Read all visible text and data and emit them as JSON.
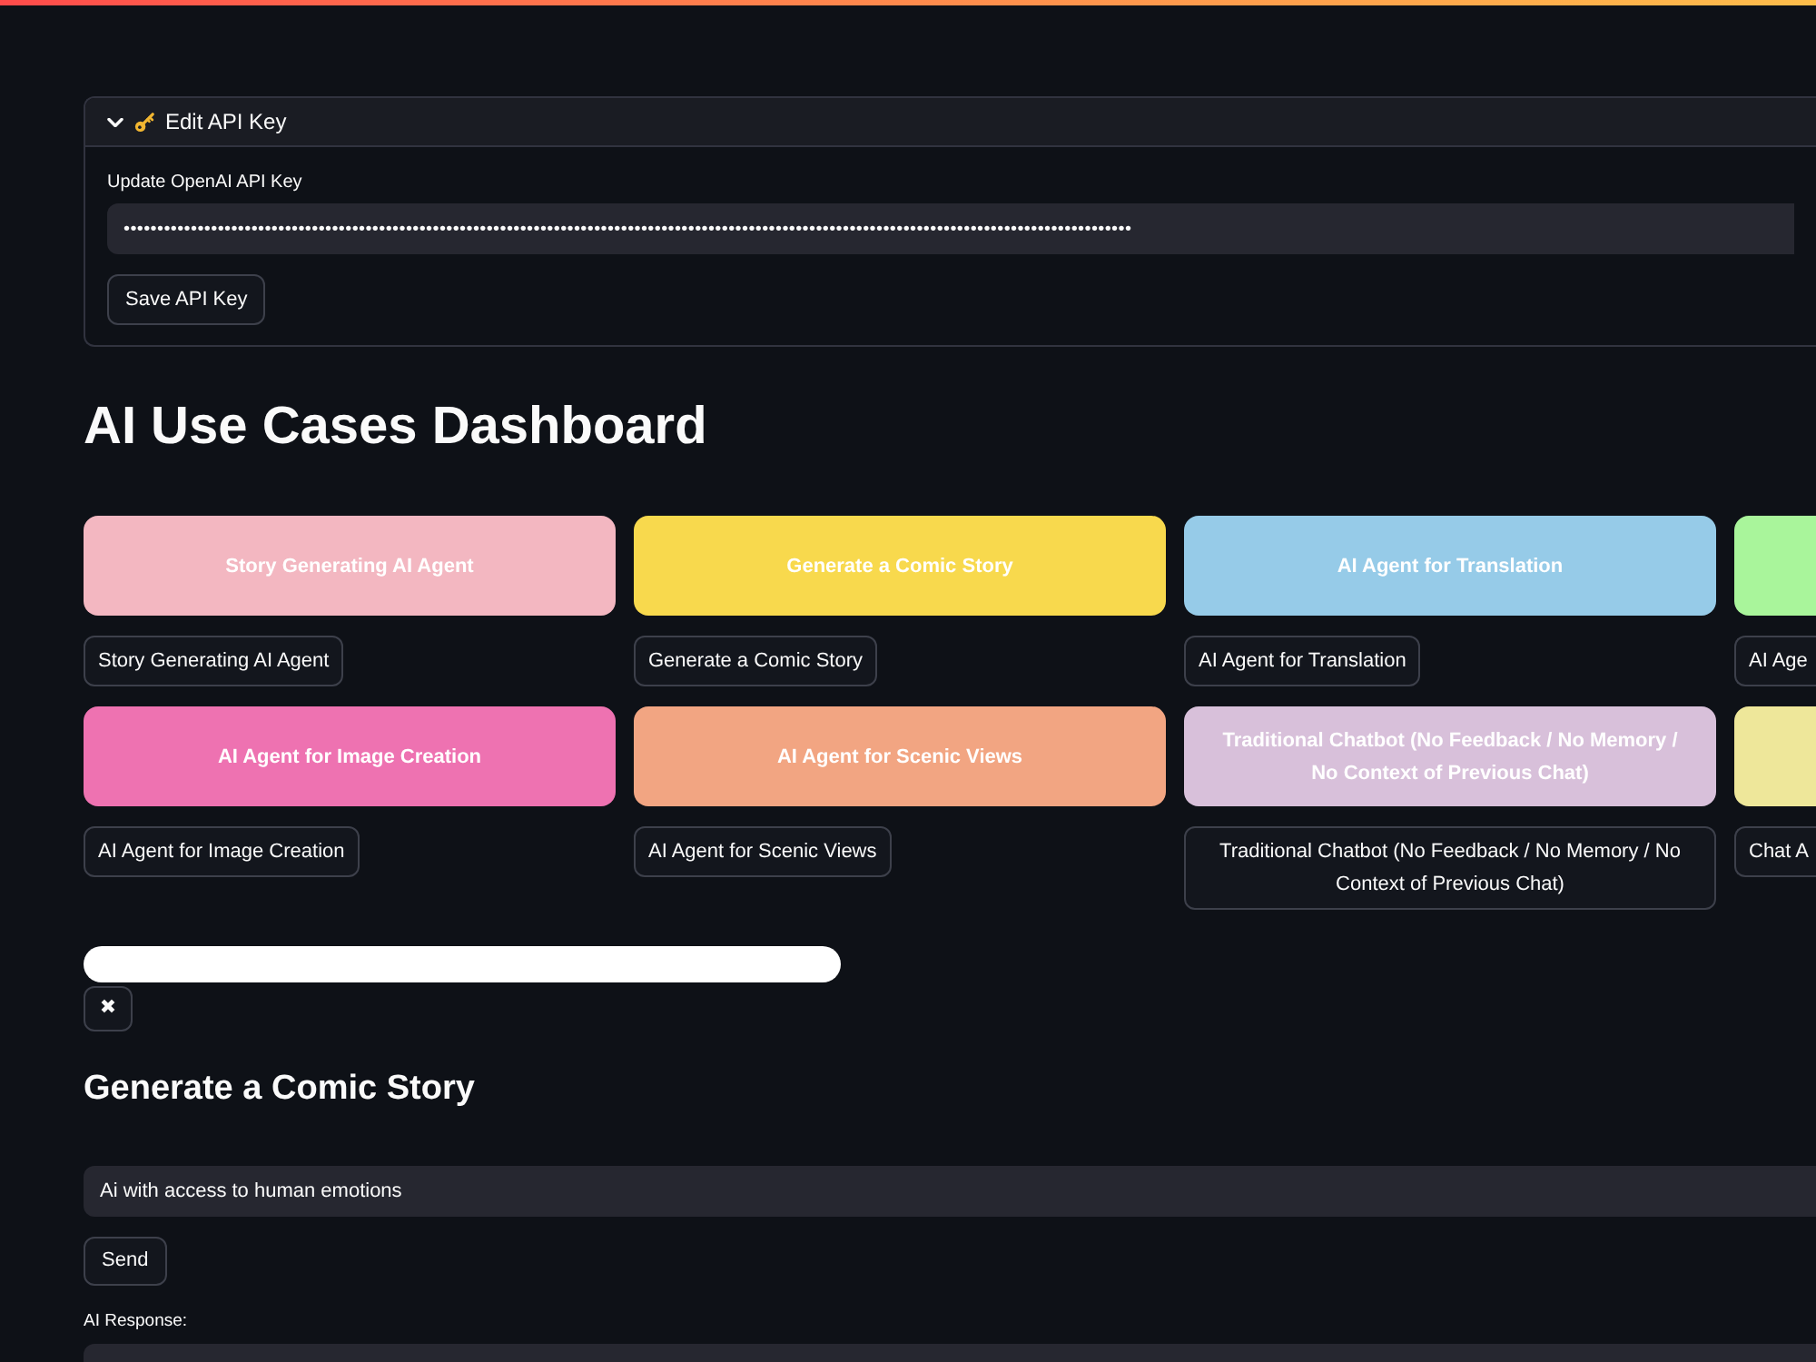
{
  "expander": {
    "title": "Edit API Key",
    "expanded": true,
    "field_label": "Update OpenAI API Key",
    "field_value": "••••••••••••••••••••••••••••••••••••••••••••••••••••••••••••••••••••••••••••••••••••••••••••••••••••••••••••••••••••••••••••••••••••••••••••••••••••••",
    "button": "Save API Key"
  },
  "title": "AI Use Cases Dashboard",
  "use_cases": [
    {
      "label": "Story Generating AI Agent",
      "color": "#f3b7c1",
      "button": "Story Generating AI Agent"
    },
    {
      "label": "Generate a Comic Story",
      "color": "#f8d94d",
      "button": "Generate a Comic Story"
    },
    {
      "label": "AI Agent for Translation",
      "color": "#96cbe8",
      "button": "AI Agent for Translation"
    },
    {
      "color": "#a9f59b",
      "button": "AI Age"
    },
    {
      "label": "AI Agent for Image Creation",
      "color": "#ee72b1",
      "button": "AI Agent for Image Creation"
    },
    {
      "label": "AI Agent for Scenic Views",
      "color": "#f2a582",
      "button": "AI Agent for Scenic Views"
    },
    {
      "label": "Traditional Chatbot (No Feedback / No Memory / No Context of Previous Chat)",
      "color": "#d8c0da",
      "button": "Traditional Chatbot (No Feedback / No Memory / No Context of Previous Chat)"
    },
    {
      "color": "#eee79a",
      "button": "Chat A"
    }
  ],
  "close_button": "✖",
  "section_title": "Generate a Comic Story",
  "prompt_field": {
    "value": "Ai with access to human emotions"
  },
  "send_button": "Send",
  "response_label": "AI Response:"
}
